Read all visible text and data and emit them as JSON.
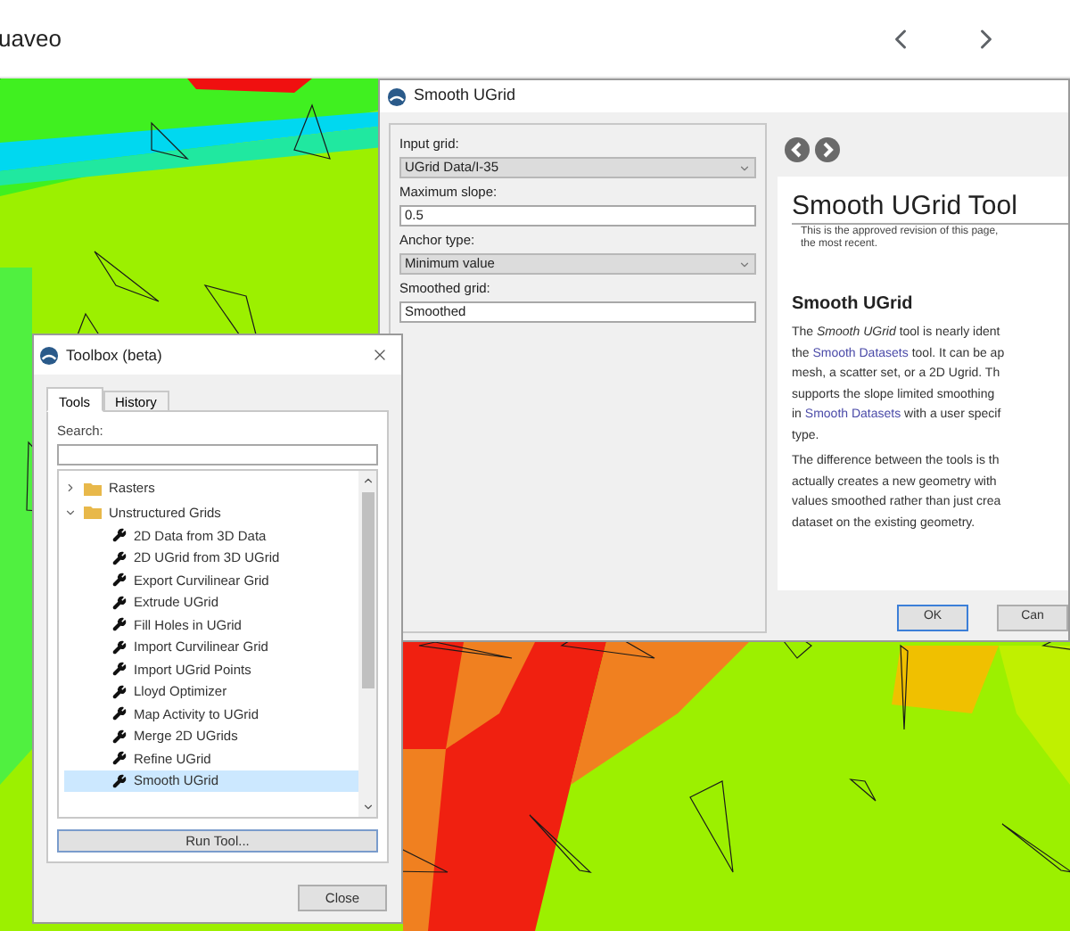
{
  "browser_bar": {
    "title": "uaveo"
  },
  "smooth_dialog": {
    "title": "Smooth UGrid",
    "fields": [
      {
        "kind": "dropdown",
        "label": "Input grid:",
        "value": "UGrid Data/I-35"
      },
      {
        "kind": "text",
        "label": "Maximum slope:",
        "value": "0.5"
      },
      {
        "kind": "dropdown",
        "label": "Anchor type:",
        "value": "Minimum value"
      },
      {
        "kind": "text",
        "label": "Smoothed grid:",
        "value": "Smoothed"
      }
    ],
    "help": {
      "title": "Smooth UGrid Tool",
      "subtitle": [
        "This is the approved revision of this page,",
        "the most recent."
      ],
      "heading": "Smooth UGrid",
      "paragraphs": [
        [
          [
            {
              "kind": "text",
              "text": "The "
            },
            {
              "kind": "italic",
              "text": "Smooth UGrid"
            },
            {
              "kind": "text",
              "text": " tool is nearly ident"
            }
          ],
          [
            {
              "kind": "text",
              "text": "the "
            },
            {
              "kind": "link",
              "text": "Smooth Datasets"
            },
            {
              "kind": "text",
              "text": " tool. It can be ap"
            }
          ],
          [
            {
              "kind": "text",
              "text": "mesh, a scatter set, or a 2D Ugrid. Th"
            }
          ],
          [
            {
              "kind": "text",
              "text": "supports the slope limited smoothing"
            }
          ],
          [
            {
              "kind": "text",
              "text": "in "
            },
            {
              "kind": "link",
              "text": "Smooth Datasets"
            },
            {
              "kind": "text",
              "text": " with a user specif"
            }
          ],
          [
            {
              "kind": "text",
              "text": "type."
            }
          ]
        ],
        [
          [
            {
              "kind": "text",
              "text": "The difference between the tools is th"
            }
          ],
          [
            {
              "kind": "text",
              "text": "actually creates a new geometry with"
            }
          ],
          [
            {
              "kind": "text",
              "text": "values smoothed rather than just crea"
            }
          ],
          [
            {
              "kind": "text",
              "text": "dataset on the existing geometry."
            }
          ]
        ]
      ]
    },
    "buttons": [
      {
        "label": "OK",
        "focused": true
      },
      {
        "label": "Can",
        "focused": false
      }
    ]
  },
  "toolbox": {
    "title": "Toolbox (beta)",
    "tabs": [
      {
        "label": "Tools",
        "selected": true
      },
      {
        "label": "History",
        "selected": false
      }
    ],
    "search": {
      "label": "Search:"
    },
    "tree": [
      {
        "label": "Rasters",
        "expanded": false
      },
      {
        "label": "Unstructured Grids",
        "expanded": true,
        "children": [
          {
            "label": "2D Data from 3D Data",
            "selected": false
          },
          {
            "label": "2D UGrid from 3D UGrid",
            "selected": false
          },
          {
            "label": "Export Curvilinear Grid",
            "selected": false
          },
          {
            "label": "Extrude UGrid",
            "selected": false
          },
          {
            "label": "Fill Holes in UGrid",
            "selected": false
          },
          {
            "label": "Import Curvilinear Grid",
            "selected": false
          },
          {
            "label": "Import UGrid Points",
            "selected": false
          },
          {
            "label": "Lloyd Optimizer",
            "selected": false
          },
          {
            "label": "Map Activity to UGrid",
            "selected": false
          },
          {
            "label": "Merge 2D UGrids",
            "selected": false
          },
          {
            "label": "Refine UGrid",
            "selected": false
          },
          {
            "label": "Smooth UGrid",
            "selected": true
          }
        ]
      }
    ],
    "run_button": "Run Tool...",
    "close_button": "Close"
  }
}
